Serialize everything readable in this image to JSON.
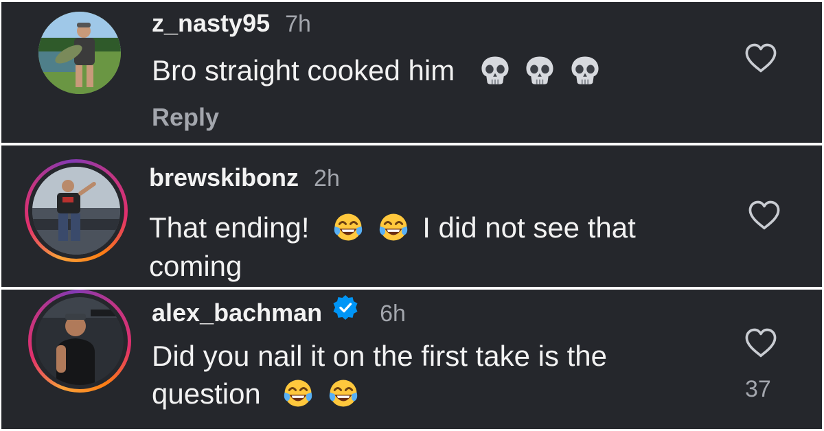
{
  "comments": [
    {
      "username": "z_nasty95",
      "time": "7h",
      "text_before": "Bro straight cooked him",
      "emojis": [
        "skull-emoji",
        "skull-emoji",
        "skull-emoji"
      ],
      "text_after": "",
      "reply_label": "Reply",
      "has_story_ring": false,
      "verified": false,
      "like_icon": "heart-outline-icon"
    },
    {
      "username": "brewskibonz",
      "time": "2h",
      "text_before": "That ending!",
      "emojis": [
        "tears-of-joy-emoji",
        "tears-of-joy-emoji"
      ],
      "text_after": "I did not see that",
      "text_line2": "coming",
      "has_story_ring": true,
      "verified": false,
      "like_icon": "heart-outline-icon"
    },
    {
      "username": "alex_bachman",
      "time": "6h",
      "text_line1": "Did you nail it on the first take is the",
      "text_before": "question",
      "emojis": [
        "tears-of-joy-emoji",
        "tears-of-joy-emoji"
      ],
      "has_story_ring": true,
      "verified": true,
      "verified_icon": "verified-badge-icon",
      "like_icon": "heart-outline-icon",
      "like_count": "37"
    }
  ],
  "colors": {
    "panel_bg": "#25272c",
    "text": "#f2f2f2",
    "muted": "#a3a6ad",
    "verified_blue": "#0095f6"
  }
}
